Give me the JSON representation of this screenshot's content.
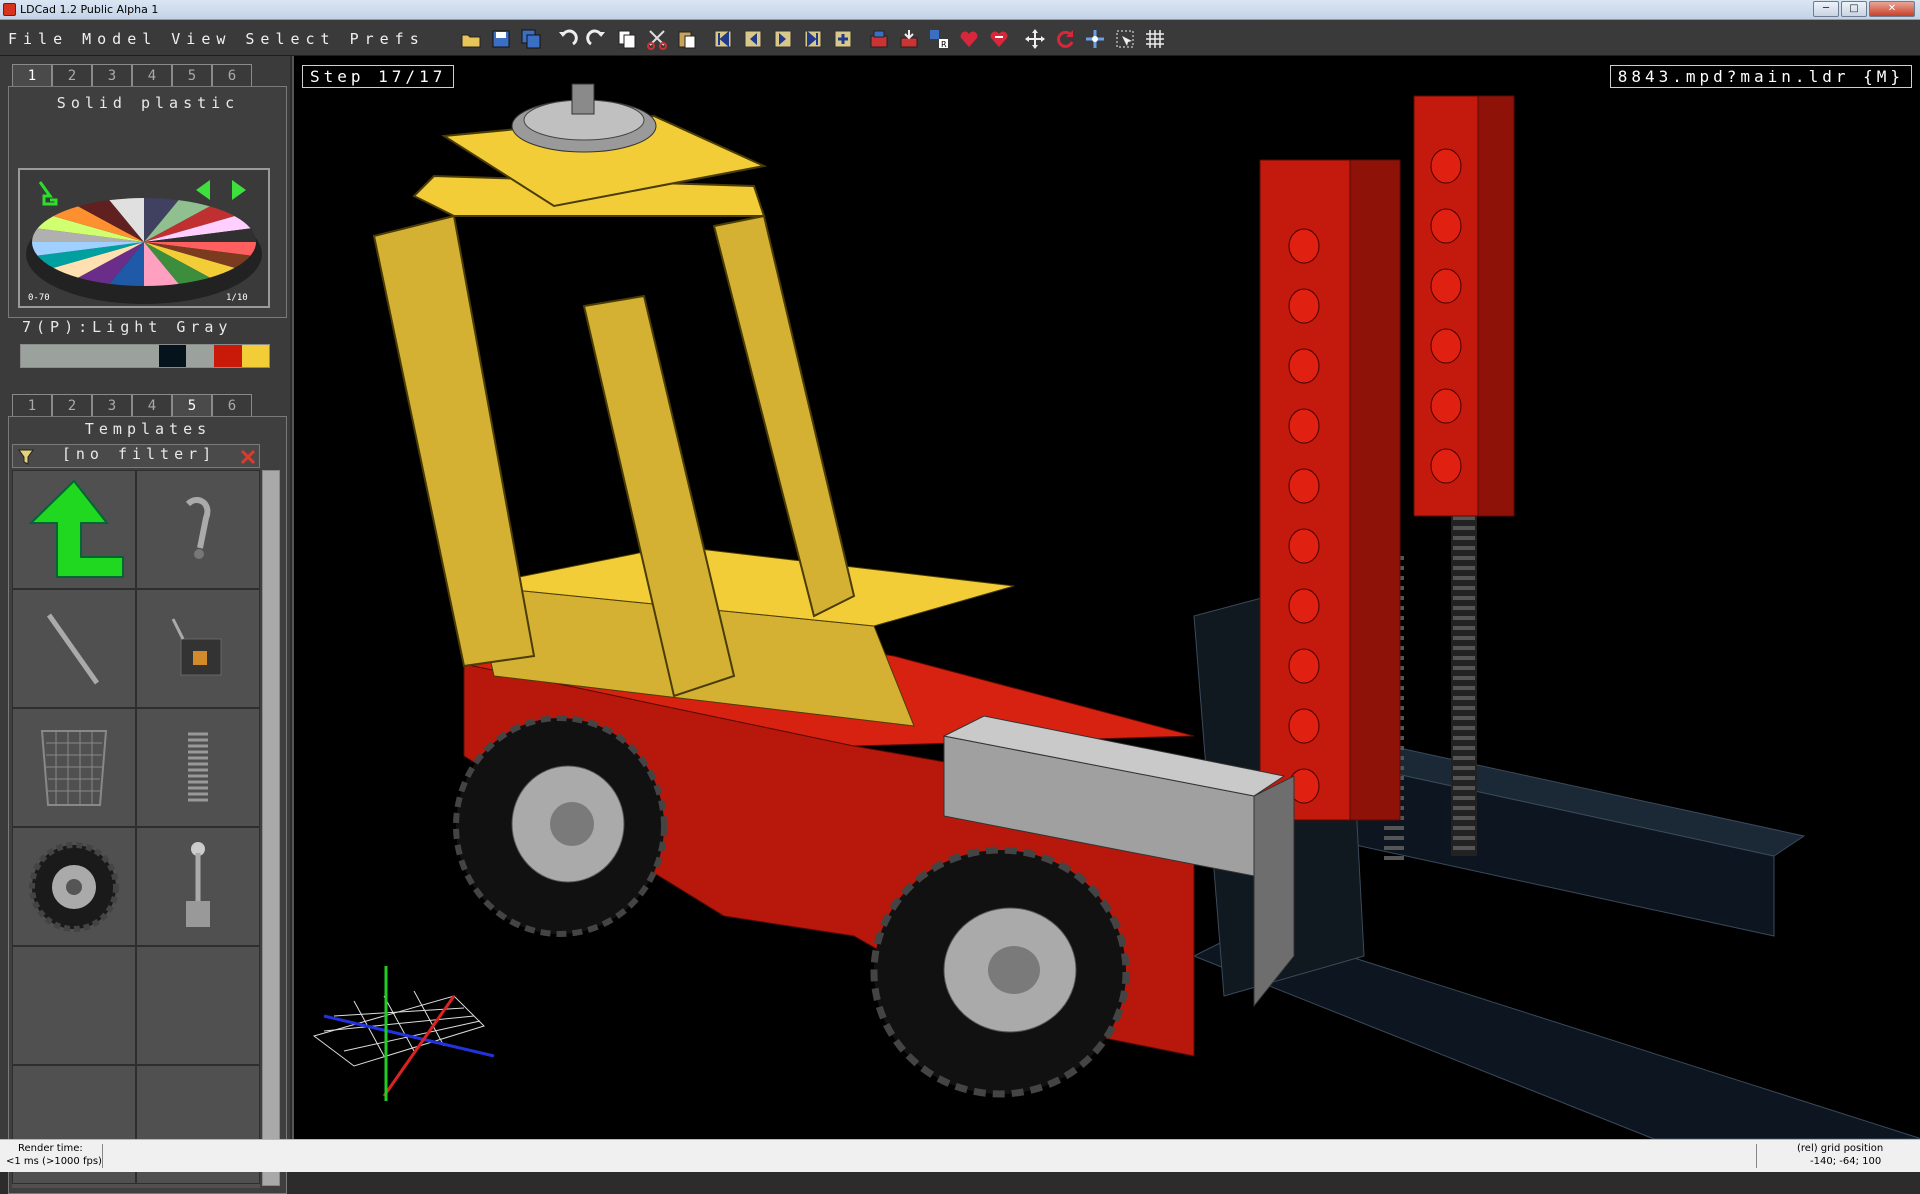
{
  "window": {
    "title": "LDCad 1.2 Public Alpha 1"
  },
  "menus": [
    "File",
    "Model",
    "View",
    "Select",
    "Prefs"
  ],
  "toolbar": {
    "icons": [
      "open-icon",
      "save-icon",
      "save-all-icon",
      "undo-icon",
      "redo-icon",
      "copy-icon",
      "cut-icon",
      "paste-icon",
      "first-step-icon",
      "prev-step-icon",
      "next-step-icon",
      "last-step-icon",
      "add-step-icon",
      "submodel-icon",
      "insert-icon",
      "rotate-set-icon",
      "heart-icon",
      "heart-remove-icon",
      "move-icon",
      "rotate-icon",
      "pan-icon",
      "select-tool-icon",
      "grid-icon"
    ]
  },
  "colors_panel": {
    "tabs": [
      "1",
      "2",
      "3",
      "4",
      "5",
      "6"
    ],
    "active_tab": "1",
    "title": "Solid plastic",
    "range_left": "0-70",
    "range_right": "1/10",
    "current_color": "7(P):Light Gray",
    "swatches": [
      "#9ba19d",
      "#9ba19d",
      "#9ba19d",
      "#9ba19d",
      "#9ba19d",
      "#05131d",
      "#9ba19d",
      "#c91a09",
      "#f2cd37"
    ]
  },
  "parts_panel": {
    "tabs": [
      "1",
      "2",
      "3",
      "4",
      "5",
      "6"
    ],
    "active_tab": "5",
    "title": "Templates",
    "filter": "[no filter]"
  },
  "viewport": {
    "step_label": "Step 17/17",
    "model_label": "8843.mpd?main.ldr {M}"
  },
  "status": {
    "render_label": "Render time:",
    "render_value": "<1 ms (>1000 fps)",
    "grid_label": "(rel) grid position",
    "grid_value": "-140; -64; 100"
  }
}
